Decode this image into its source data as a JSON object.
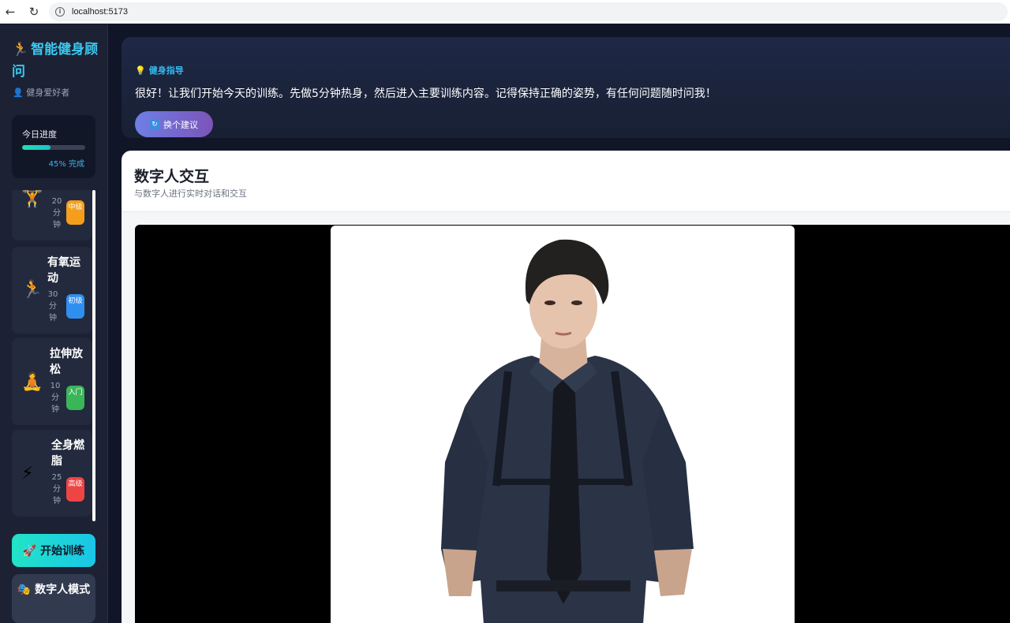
{
  "browser": {
    "url": "localhost:5173"
  },
  "sidebar": {
    "brand_icon": "🏃",
    "brand": "智能健身顾问",
    "user_icon": "👤",
    "user": "健身爱好者",
    "progress": {
      "label": "今日进度",
      "percent": 45,
      "text": "45% 完成"
    },
    "workouts": [
      {
        "icon": "🏋️",
        "title": "",
        "duration": "20 分 钟",
        "level": "中级",
        "level_color": "#f59e1b"
      },
      {
        "icon": "🏃",
        "title": "有氧运动",
        "duration": "30 分 钟",
        "level": "初级",
        "level_color": "#2f8ff0"
      },
      {
        "icon": "🧘",
        "title": "拉伸放松",
        "duration": "10 分 钟",
        "level": "入门",
        "level_color": "#3bb55a"
      },
      {
        "icon": "⚡",
        "title": "全身燃脂",
        "duration": "25 分 钟",
        "level": "高级",
        "level_color": "#ef4444"
      }
    ],
    "start_button": "🚀 开始训练",
    "digital_human_button": "🎭 数字人模式"
  },
  "tip": {
    "icon": "💡",
    "heading": "健身指导",
    "text": "很好！让我们开始今天的训练。先做5分钟热身，然后进入主要训练内容。记得保持正确的姿势，有任何问题随时问我！",
    "swap_icon": "🔄",
    "swap_label": "换个建议"
  },
  "panel": {
    "title": "数字人交互",
    "subtitle": "与数字人进行实时对话和交互"
  }
}
